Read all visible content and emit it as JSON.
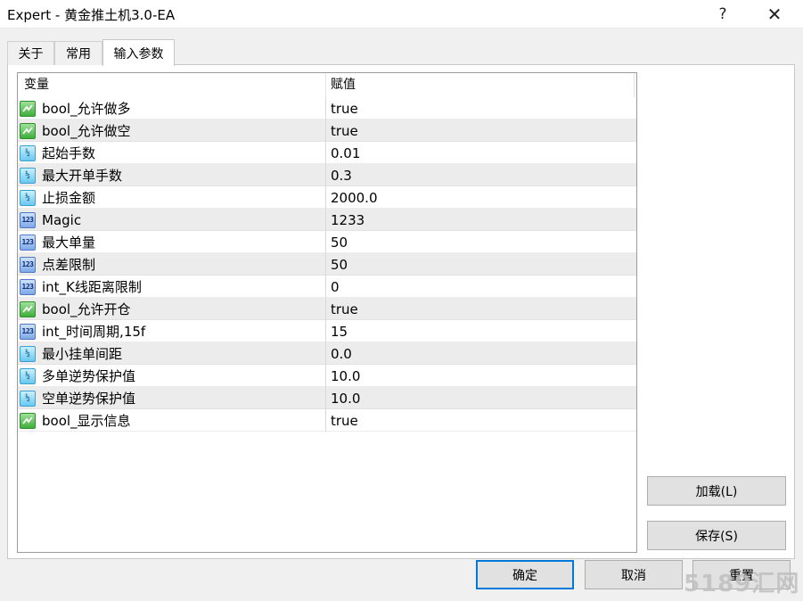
{
  "window": {
    "title": "Expert - 黄金推土机3.0-EA",
    "help": "?",
    "close": "✕"
  },
  "tabs": [
    {
      "label": "关于",
      "active": false
    },
    {
      "label": "常用",
      "active": false
    },
    {
      "label": "输入参数",
      "active": true
    }
  ],
  "grid": {
    "headers": {
      "variable": "变量",
      "value": "赋值"
    },
    "rows": [
      {
        "type": "bool",
        "name": "bool_允许做多",
        "value": "true"
      },
      {
        "type": "bool",
        "name": "bool_允许做空",
        "value": "true"
      },
      {
        "type": "double",
        "name": "起始手数",
        "value": "0.01"
      },
      {
        "type": "double",
        "name": "最大开单手数",
        "value": "0.3"
      },
      {
        "type": "double",
        "name": "止损金额",
        "value": "2000.0"
      },
      {
        "type": "int",
        "name": "Magic",
        "value": "1233"
      },
      {
        "type": "int",
        "name": "最大单量",
        "value": "50"
      },
      {
        "type": "int",
        "name": "点差限制",
        "value": "50"
      },
      {
        "type": "int",
        "name": "int_K线距离限制",
        "value": "0"
      },
      {
        "type": "bool",
        "name": "bool_允许开仓",
        "value": "true"
      },
      {
        "type": "int",
        "name": "int_时间周期,15f",
        "value": "15"
      },
      {
        "type": "double",
        "name": "最小挂单间距",
        "value": "0.0"
      },
      {
        "type": "double",
        "name": "多单逆势保护值",
        "value": "10.0"
      },
      {
        "type": "double",
        "name": "空单逆势保护值",
        "value": "10.0"
      },
      {
        "type": "bool",
        "name": "bool_显示信息",
        "value": "true"
      }
    ]
  },
  "icon_names": {
    "bool": "bool-icon",
    "double": "double-icon",
    "int": "int-icon"
  },
  "icon_glyphs": {
    "double": "½",
    "int": "123"
  },
  "buttons": {
    "load": "加载(L)",
    "save": "保存(S)",
    "ok": "确定",
    "cancel": "取消",
    "reset": "重置"
  },
  "watermark": "5189汇网",
  "colors": {
    "ok_border": "#0078d7",
    "bool_icon": "#3fae3a",
    "double_icon": "#6cc8ef",
    "int_icon": "#7ea8e6"
  }
}
